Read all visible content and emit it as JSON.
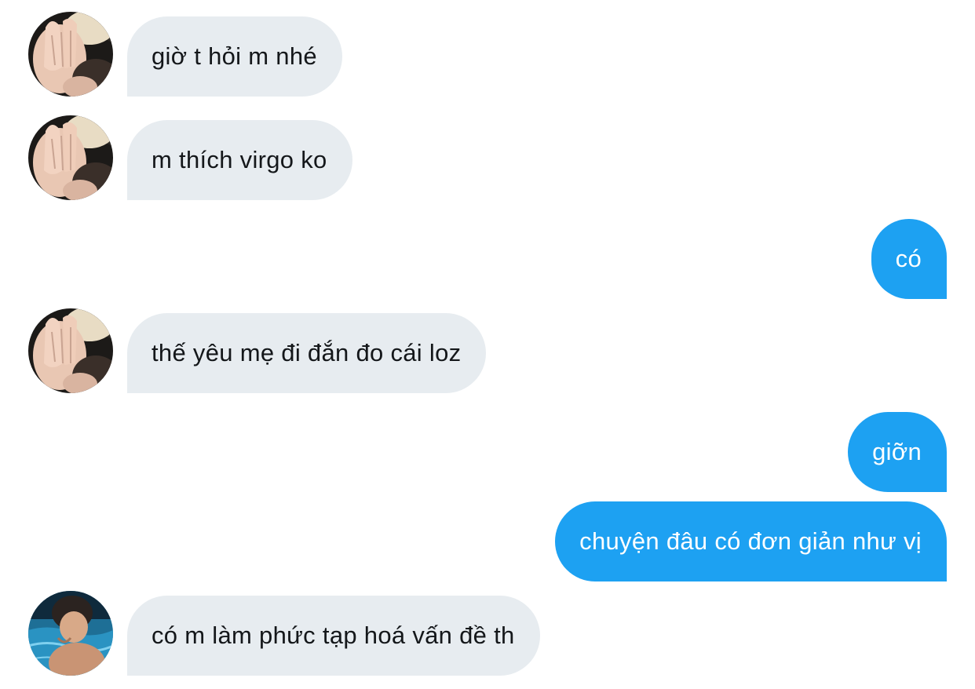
{
  "conversation": {
    "messages": [
      {
        "sender": "other",
        "avatar": "blonde-girl-avatar",
        "text": "giờ t hỏi m nhé"
      },
      {
        "sender": "other",
        "avatar": "blonde-girl-avatar",
        "text": "m thích virgo ko"
      },
      {
        "sender": "me",
        "text": "có"
      },
      {
        "sender": "other",
        "avatar": "blonde-girl-avatar",
        "text": "thế yêu mẹ đi đắn đo cái loz"
      },
      {
        "sender": "me",
        "text": "giỡn"
      },
      {
        "sender": "me",
        "text": "chuyện đâu có đơn giản như vị"
      },
      {
        "sender": "other",
        "avatar": "pool-boy-avatar",
        "text": "có m làm phức tạp hoá vấn đề th"
      }
    ]
  },
  "colors": {
    "incoming_bubble": "#e7ecf0",
    "incoming_text": "#14171a",
    "outgoing_bubble": "#1da1f2",
    "outgoing_text": "#ffffff",
    "background": "#ffffff"
  }
}
